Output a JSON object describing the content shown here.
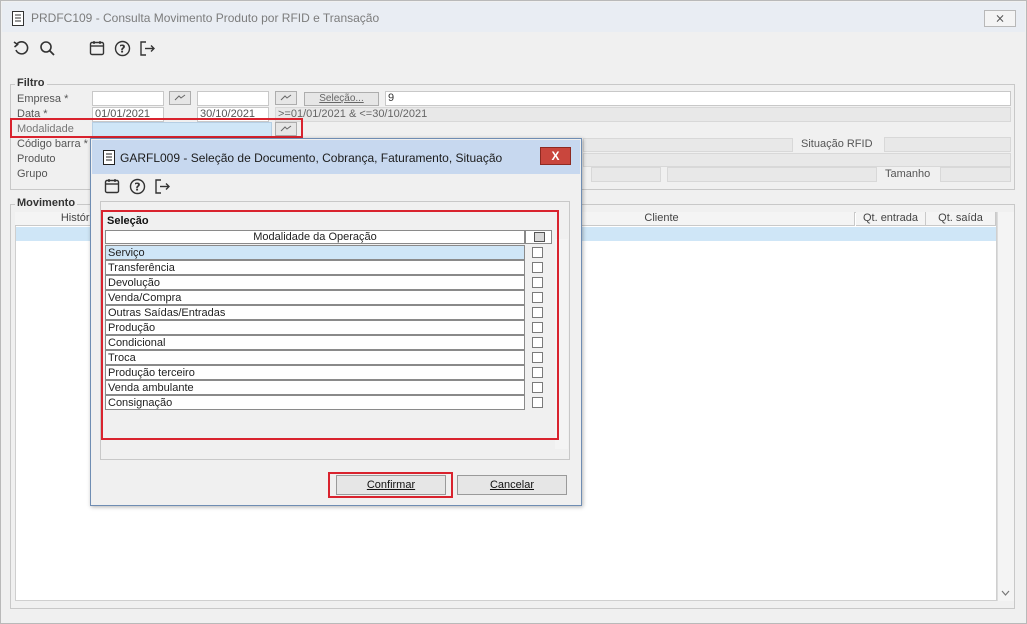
{
  "window": {
    "title": "PRDFC109 - Consulta Movimento Produto por RFID e Transação",
    "close_label": "⨯"
  },
  "toolbar": {
    "icons": [
      "refresh-icon",
      "search-icon",
      "calendar-icon",
      "help-icon",
      "exit-icon"
    ]
  },
  "filtro": {
    "legend": "Filtro",
    "empresa_label": "Empresa *",
    "data_label": "Data *",
    "modalidade_label": "Modalidade",
    "codigo_barra_label": "Código barra *",
    "produto_label": "Produto",
    "grupo_label": "Grupo",
    "data_inicio": "01/01/2021",
    "data_fim": "30/10/2021",
    "selecao_label": "Seleção...",
    "selecao_value": "9",
    "data_range_text": ">=01/01/2021 & <=30/10/2021",
    "situacao_rfid_label": "Situação RFID",
    "tamanho_label": "Tamanho"
  },
  "movimento": {
    "legend": "Movimento",
    "columns": [
      "Históri",
      "Cliente",
      "Qt. entrada",
      "Qt. saída"
    ]
  },
  "dialog": {
    "title": "GARFL009 - Seleção de Documento, Cobrança, Faturamento, Situação",
    "close_label": "X",
    "section_label": "Seleção",
    "column_header": "Modalidade da Operação",
    "items": [
      {
        "label": "Serviço",
        "checked": false
      },
      {
        "label": "Transferência",
        "checked": false
      },
      {
        "label": "Devolução",
        "checked": false
      },
      {
        "label": "Venda/Compra",
        "checked": false
      },
      {
        "label": "Outras Saídas/Entradas",
        "checked": false
      },
      {
        "label": "Produção",
        "checked": false
      },
      {
        "label": "Condicional",
        "checked": false
      },
      {
        "label": "Troca",
        "checked": false
      },
      {
        "label": "Produção terceiro",
        "checked": false
      },
      {
        "label": "Venda ambulante",
        "checked": false
      },
      {
        "label": "Consignação",
        "checked": false
      }
    ],
    "confirm_label": "Confirmar",
    "cancel_label": "Cancelar"
  },
  "colors": {
    "highlight_red": "#d9232e",
    "selected_row": "#cfe6f7",
    "dialog_title_bg": "#c7d8ef"
  }
}
